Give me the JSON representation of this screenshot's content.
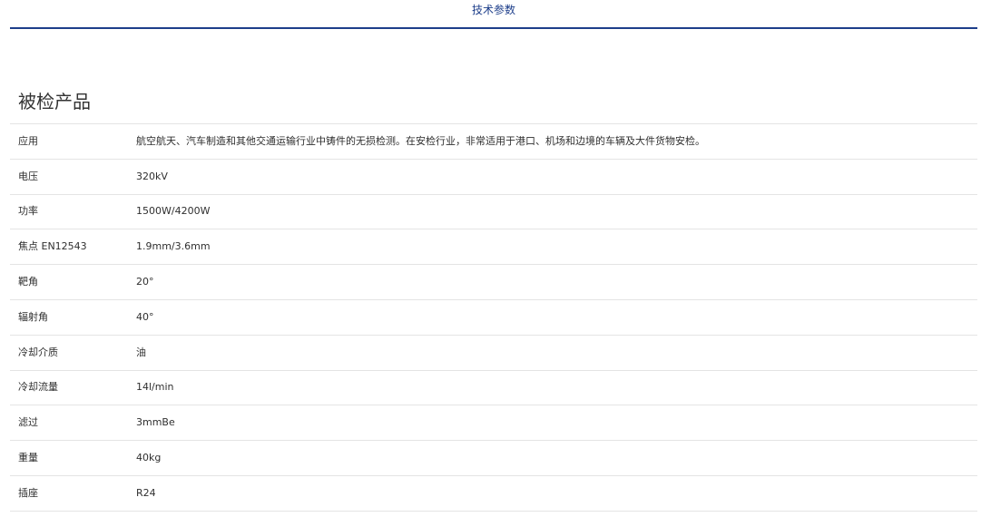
{
  "tabs": {
    "active_label": "技术参数"
  },
  "section": {
    "title": "被检产品"
  },
  "specs": [
    {
      "label": "应用",
      "value": "航空航天、汽车制造和其他交通运输行业中铸件的无损检测。在安检行业，非常适用于港口、机场和边境的车辆及大件货物安检。"
    },
    {
      "label": "电压",
      "value": "320kV"
    },
    {
      "label": "功率",
      "value": "1500W/4200W"
    },
    {
      "label": "焦点 EN12543",
      "value": "1.9mm/3.6mm"
    },
    {
      "label": "靶角",
      "value": "20°"
    },
    {
      "label": "辐射角",
      "value": "40°"
    },
    {
      "label": "冷却介质",
      "value": "油"
    },
    {
      "label": "冷却流量",
      "value": "14l/min"
    },
    {
      "label": "滤过",
      "value": "3mmBe"
    },
    {
      "label": "重量",
      "value": "40kg"
    },
    {
      "label": "插座",
      "value": "R24"
    }
  ],
  "colors": {
    "accent": "#1d3e8a",
    "divider": "#e4e4e4",
    "text": "#2f2f2f"
  }
}
